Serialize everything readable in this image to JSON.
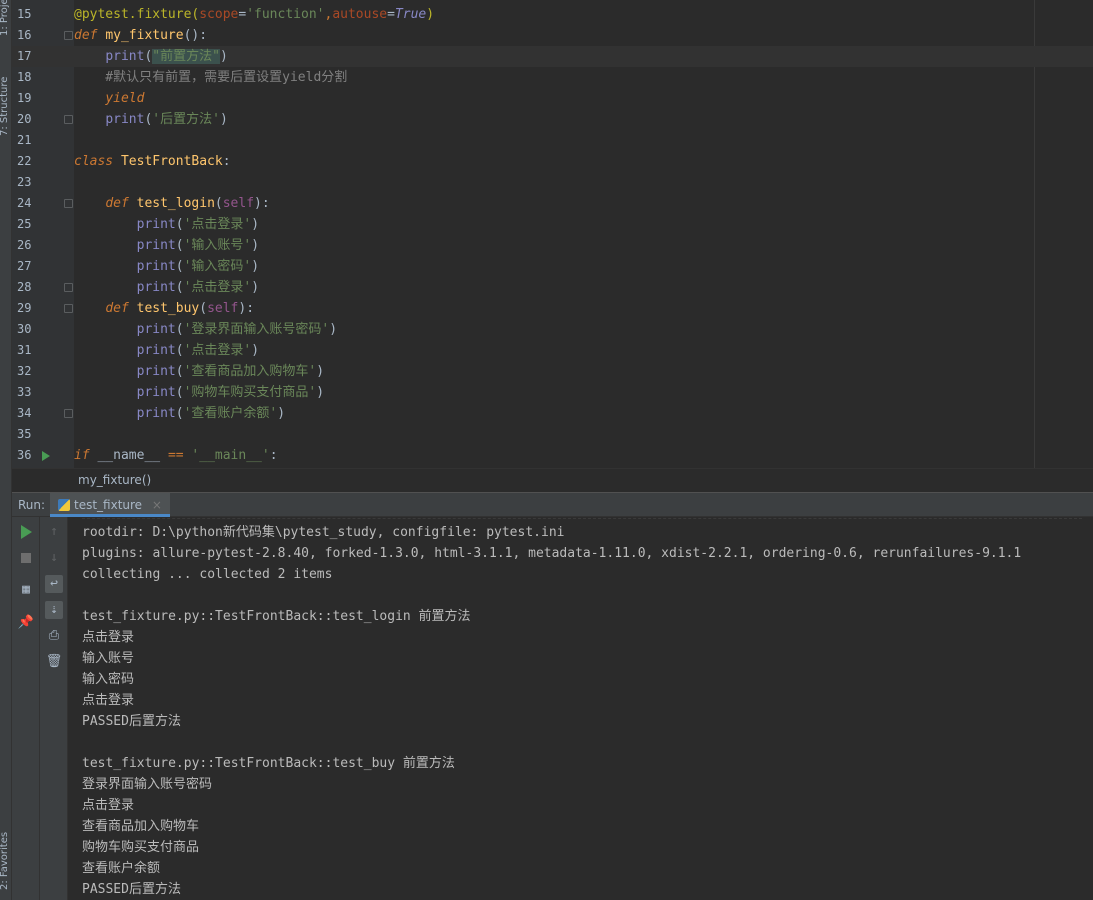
{
  "tool_strip": {
    "project_label": "1: Project",
    "structure_label": "7: Structure",
    "favorites_label": "2: Favorites"
  },
  "editor": {
    "lines": [
      {
        "num": "15",
        "segments": [
          {
            "t": "@pytest.fixture(",
            "c": "dec"
          },
          {
            "t": "scope",
            "c": "named"
          },
          {
            "t": "=",
            "c": "plain"
          },
          {
            "t": "'function'",
            "c": "str"
          },
          {
            "t": ",",
            "c": "kw"
          },
          {
            "t": "autouse",
            "c": "named"
          },
          {
            "t": "=",
            "c": "plain"
          },
          {
            "t": "True",
            "c": "bool"
          },
          {
            "t": ")",
            "c": "dec"
          }
        ]
      },
      {
        "num": "16",
        "segments": [
          {
            "t": "def ",
            "c": "ikw"
          },
          {
            "t": "my_fixture",
            "c": "fn"
          },
          {
            "t": "():",
            "c": "plain"
          }
        ]
      },
      {
        "num": "17",
        "segments": [
          {
            "t": "    ",
            "c": "plain"
          },
          {
            "t": "print",
            "c": "builtin"
          },
          {
            "t": "(",
            "c": "plain"
          },
          {
            "t": "\"前置方法\"",
            "c": "str hl-str"
          },
          {
            "t": ")",
            "c": "plain"
          }
        ]
      },
      {
        "num": "18",
        "segments": [
          {
            "t": "    #默认只有前置，需要后置设置yield分割",
            "c": "cmt"
          }
        ]
      },
      {
        "num": "19",
        "segments": [
          {
            "t": "    ",
            "c": "plain"
          },
          {
            "t": "yield",
            "c": "ikw"
          }
        ]
      },
      {
        "num": "20",
        "segments": [
          {
            "t": "    ",
            "c": "plain"
          },
          {
            "t": "print",
            "c": "builtin"
          },
          {
            "t": "(",
            "c": "plain"
          },
          {
            "t": "'后置方法'",
            "c": "str"
          },
          {
            "t": ")",
            "c": "plain"
          }
        ]
      },
      {
        "num": "21",
        "segments": []
      },
      {
        "num": "22",
        "segments": [
          {
            "t": "class ",
            "c": "ikw"
          },
          {
            "t": "TestFrontBack",
            "c": "fn"
          },
          {
            "t": ":",
            "c": "plain"
          }
        ]
      },
      {
        "num": "23",
        "segments": []
      },
      {
        "num": "24",
        "segments": [
          {
            "t": "    ",
            "c": "plain"
          },
          {
            "t": "def ",
            "c": "ikw"
          },
          {
            "t": "test_login",
            "c": "fn"
          },
          {
            "t": "(",
            "c": "plain"
          },
          {
            "t": "self",
            "c": "selfk"
          },
          {
            "t": "):",
            "c": "plain"
          }
        ]
      },
      {
        "num": "25",
        "segments": [
          {
            "t": "        ",
            "c": "plain"
          },
          {
            "t": "print",
            "c": "builtin"
          },
          {
            "t": "(",
            "c": "plain"
          },
          {
            "t": "'点击登录'",
            "c": "str"
          },
          {
            "t": ")",
            "c": "plain"
          }
        ]
      },
      {
        "num": "26",
        "segments": [
          {
            "t": "        ",
            "c": "plain"
          },
          {
            "t": "print",
            "c": "builtin"
          },
          {
            "t": "(",
            "c": "plain"
          },
          {
            "t": "'输入账号'",
            "c": "str"
          },
          {
            "t": ")",
            "c": "plain"
          }
        ]
      },
      {
        "num": "27",
        "segments": [
          {
            "t": "        ",
            "c": "plain"
          },
          {
            "t": "print",
            "c": "builtin"
          },
          {
            "t": "(",
            "c": "plain"
          },
          {
            "t": "'输入密码'",
            "c": "str"
          },
          {
            "t": ")",
            "c": "plain"
          }
        ]
      },
      {
        "num": "28",
        "segments": [
          {
            "t": "        ",
            "c": "plain"
          },
          {
            "t": "print",
            "c": "builtin"
          },
          {
            "t": "(",
            "c": "plain"
          },
          {
            "t": "'点击登录'",
            "c": "str"
          },
          {
            "t": ")",
            "c": "plain"
          }
        ]
      },
      {
        "num": "29",
        "segments": [
          {
            "t": "    ",
            "c": "plain"
          },
          {
            "t": "def ",
            "c": "ikw"
          },
          {
            "t": "test_buy",
            "c": "fn"
          },
          {
            "t": "(",
            "c": "plain"
          },
          {
            "t": "self",
            "c": "selfk"
          },
          {
            "t": "):",
            "c": "plain"
          }
        ]
      },
      {
        "num": "30",
        "segments": [
          {
            "t": "        ",
            "c": "plain"
          },
          {
            "t": "print",
            "c": "builtin"
          },
          {
            "t": "(",
            "c": "plain"
          },
          {
            "t": "'登录界面输入账号密码'",
            "c": "str"
          },
          {
            "t": ")",
            "c": "plain"
          }
        ]
      },
      {
        "num": "31",
        "segments": [
          {
            "t": "        ",
            "c": "plain"
          },
          {
            "t": "print",
            "c": "builtin"
          },
          {
            "t": "(",
            "c": "plain"
          },
          {
            "t": "'点击登录'",
            "c": "str"
          },
          {
            "t": ")",
            "c": "plain"
          }
        ]
      },
      {
        "num": "32",
        "segments": [
          {
            "t": "        ",
            "c": "plain"
          },
          {
            "t": "print",
            "c": "builtin"
          },
          {
            "t": "(",
            "c": "plain"
          },
          {
            "t": "'查看商品加入购物车'",
            "c": "str"
          },
          {
            "t": ")",
            "c": "plain"
          }
        ]
      },
      {
        "num": "33",
        "segments": [
          {
            "t": "        ",
            "c": "plain"
          },
          {
            "t": "print",
            "c": "builtin"
          },
          {
            "t": "(",
            "c": "plain"
          },
          {
            "t": "'购物车购买支付商品'",
            "c": "str"
          },
          {
            "t": ")",
            "c": "plain"
          }
        ]
      },
      {
        "num": "34",
        "segments": [
          {
            "t": "        ",
            "c": "plain"
          },
          {
            "t": "print",
            "c": "builtin"
          },
          {
            "t": "(",
            "c": "plain"
          },
          {
            "t": "'查看账户余额'",
            "c": "str"
          },
          {
            "t": ")",
            "c": "plain"
          }
        ]
      },
      {
        "num": "35",
        "segments": []
      },
      {
        "num": "36",
        "segments": [
          {
            "t": "if ",
            "c": "ikw"
          },
          {
            "t": "__name__ ",
            "c": "plain"
          },
          {
            "t": "== ",
            "c": "kw"
          },
          {
            "t": "'__main__'",
            "c": "str"
          },
          {
            "t": ":",
            "c": "plain"
          }
        ]
      }
    ],
    "caret_line": "17",
    "fold_lines": [
      "16",
      "20",
      "24",
      "28",
      "29",
      "34"
    ],
    "run_line": "36"
  },
  "breadcrumb": {
    "text": "my_fixture()"
  },
  "run_panel": {
    "label": "Run:",
    "tab_name": "test_fixture",
    "tab_close": "×"
  },
  "console": {
    "lines": [
      "rootdir: D:\\python新代码集\\pytest_study, configfile: pytest.ini",
      "plugins: allure-pytest-2.8.40, forked-1.3.0, html-3.1.1, metadata-1.11.0, xdist-2.2.1, ordering-0.6, rerunfailures-9.1.1",
      "collecting ... collected 2 items",
      "",
      "test_fixture.py::TestFrontBack::test_login 前置方法",
      "点击登录",
      "输入账号",
      "输入密码",
      "点击登录",
      "PASSED后置方法",
      "",
      "test_fixture.py::TestFrontBack::test_buy 前置方法",
      "登录界面输入账号密码",
      "点击登录",
      "查看商品加入购物车",
      "购物车购买支付商品",
      "查看账户余额",
      "PASSED后置方法"
    ]
  },
  "icons": {
    "run": "play-icon",
    "stop": "stop-icon",
    "layout": "layout-icon",
    "pin": "pin-icon",
    "up": "arrow-up-icon",
    "down": "arrow-down-icon",
    "wrap": "soft-wrap-icon",
    "scroll": "scroll-to-end-icon",
    "print": "print-icon",
    "trash": "trash-icon"
  }
}
